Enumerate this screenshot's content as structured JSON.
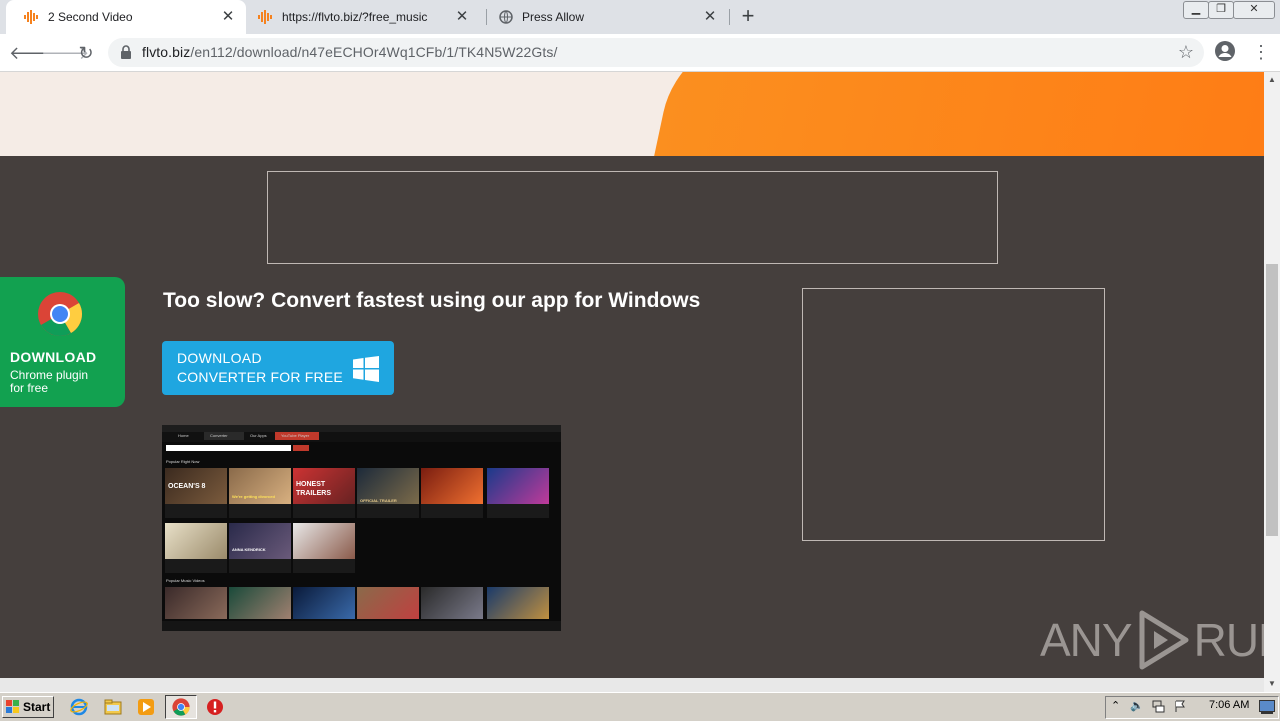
{
  "browser": {
    "tabs": [
      {
        "title": "2 Second Video",
        "active": true,
        "icon": "flvto-wave-icon"
      },
      {
        "title": "https://flvto.biz/?free_music",
        "active": false,
        "icon": "flvto-wave-icon"
      },
      {
        "title": "Press Allow",
        "active": false,
        "icon": "globe-icon"
      }
    ],
    "url_host": "flvto.biz",
    "url_path": "/en112/download/n47eECHOr4Wq1CFb/1/TK4N5W22Gts/"
  },
  "page": {
    "chrome_card": {
      "title": "DOWNLOAD",
      "subtitle_line1": "Chrome plugin",
      "subtitle_line2": "for free"
    },
    "headline": "Too slow? Convert fastest using our app for Windows",
    "download_button": {
      "line1": "DOWNLOAD",
      "line2": "CONVERTER FOR FREE"
    },
    "app_preview": {
      "nav": [
        "Home",
        "Converter",
        "Our Apps",
        "YouTube Player"
      ],
      "section1": "Popular Right Now",
      "section2": "Popular Music Videos",
      "thumbs": [
        "OCEAN'S 8",
        "We're getting divorced",
        "HONEST TRAILERS",
        "OFFICIAL TRAILER",
        "",
        "",
        "",
        "ANNA KENDRICK",
        ""
      ]
    },
    "watermark": {
      "left": "ANY",
      "right": "RUN"
    }
  },
  "taskbar": {
    "start_label": "Start",
    "clock": "7:06 AM"
  },
  "colors": {
    "page_bg": "#453f3d",
    "accent_orange": "#fb8f1f",
    "chrome_green": "#12a150",
    "download_blue": "#1fa6e0"
  }
}
